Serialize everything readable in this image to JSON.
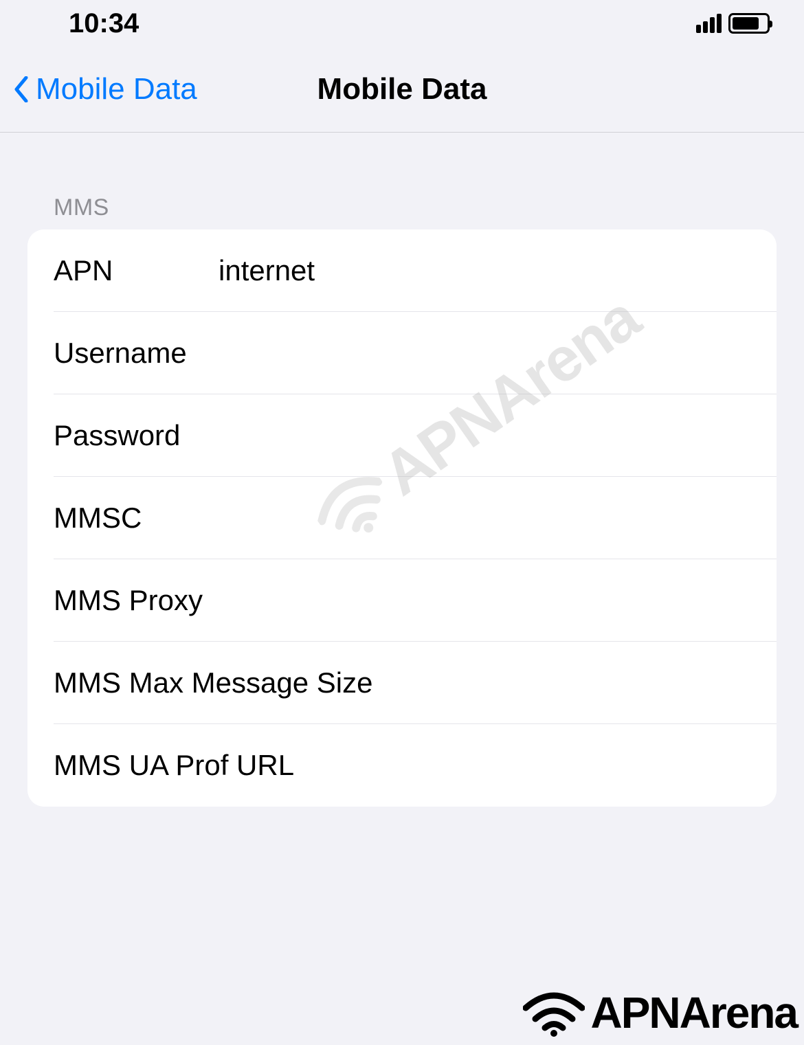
{
  "statusBar": {
    "time": "10:34"
  },
  "navBar": {
    "backLabel": "Mobile Data",
    "title": "Mobile Data"
  },
  "section": {
    "header": "MMS",
    "rows": [
      {
        "label": "APN",
        "value": "internet"
      },
      {
        "label": "Username",
        "value": ""
      },
      {
        "label": "Password",
        "value": ""
      },
      {
        "label": "MMSC",
        "value": ""
      },
      {
        "label": "MMS Proxy",
        "value": ""
      },
      {
        "label": "MMS Max Message Size",
        "value": ""
      },
      {
        "label": "MMS UA Prof URL",
        "value": ""
      }
    ]
  },
  "watermark": {
    "text": "APNArena"
  }
}
